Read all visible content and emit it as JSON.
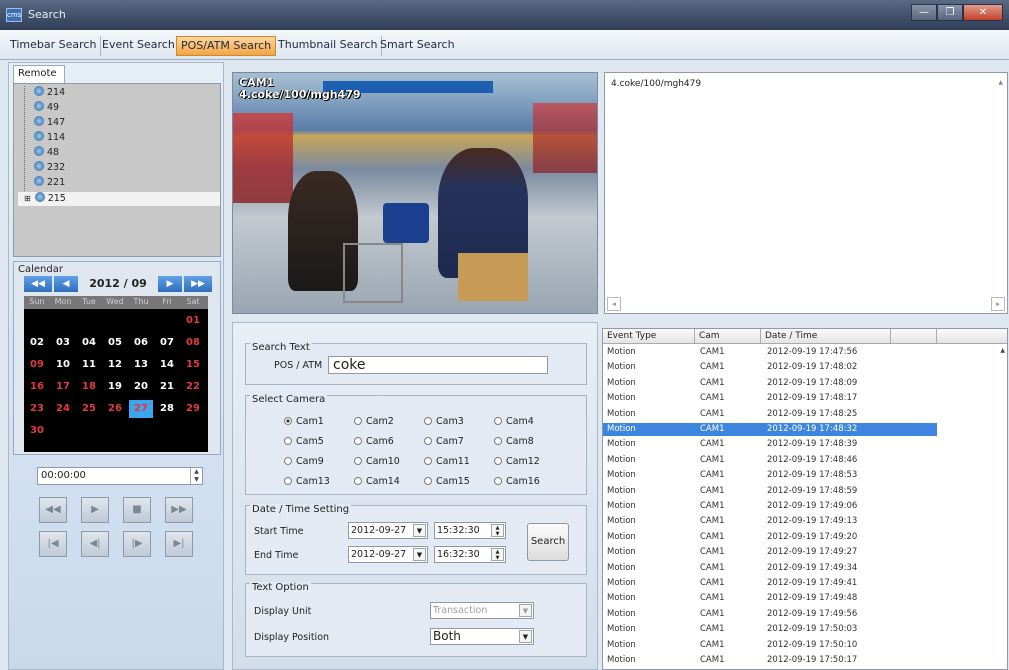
{
  "window": {
    "title": "Search",
    "app_icon": "cms",
    "buttons": [
      "—",
      "❐",
      "✕"
    ]
  },
  "tabs": [
    {
      "label": "Timebar Search",
      "active": false
    },
    {
      "label": "Event Search",
      "active": false
    },
    {
      "label": "POS/ATM Search",
      "active": true
    },
    {
      "label": "Thumbnail Search",
      "active": false
    },
    {
      "label": "Smart Search",
      "active": false
    }
  ],
  "remote": {
    "tab_label": "Remote",
    "items": [
      "214",
      "49",
      "147",
      "114",
      "48",
      "232",
      "221",
      "215"
    ],
    "selected_index": 7
  },
  "calendar": {
    "label": "Calendar",
    "month": "2012 / 09",
    "weekdays": [
      "Sun",
      "Mon",
      "Tue",
      "Wed",
      "Thu",
      "Fri",
      "Sat"
    ],
    "first_weekday_index": 6,
    "days_in_month": 30,
    "today": 27,
    "red_days": [
      1,
      8,
      9,
      15,
      16,
      17,
      18,
      22,
      23,
      24,
      25,
      26,
      29,
      30
    ]
  },
  "playback": {
    "time": "00:00:00",
    "row1": [
      "◀◀",
      "▶",
      "■",
      "▶▶"
    ],
    "row2": [
      "|◀",
      "◀|",
      "|▶",
      "▶|"
    ]
  },
  "video": {
    "camera": "CAM1",
    "overlay": "4.coke/100/mgh479"
  },
  "text_panel": {
    "content": "4.coke/100/mgh479"
  },
  "search": {
    "search_text": {
      "title": "Search Text",
      "label": "POS / ATM",
      "value": "coke"
    },
    "select_camera": {
      "title": "Select Camera",
      "cameras": [
        "Cam1",
        "Cam2",
        "Cam3",
        "Cam4",
        "Cam5",
        "Cam6",
        "Cam7",
        "Cam8",
        "Cam9",
        "Cam10",
        "Cam11",
        "Cam12",
        "Cam13",
        "Cam14",
        "Cam15",
        "Cam16"
      ],
      "selected": "Cam1"
    },
    "datetime": {
      "title": "Date / Time Setting",
      "start_label": "Start Time",
      "start_date": "2012-09-27",
      "start_time": "15:32:30",
      "end_label": "End Time",
      "end_date": "2012-09-27",
      "end_time": "16:32:30",
      "search_button": "Search"
    },
    "text_option": {
      "title": "Text Option",
      "unit_label": "Display Unit",
      "unit_value": "Transaction",
      "position_label": "Display Position",
      "position_value": "Both"
    }
  },
  "events": {
    "columns": [
      "Event Type",
      "Cam",
      "Date / Time",
      ""
    ],
    "selected_index": 5,
    "rows": [
      {
        "type": "Motion",
        "cam": "CAM1",
        "time": "2012-09-19 17:47:56"
      },
      {
        "type": "Motion",
        "cam": "CAM1",
        "time": "2012-09-19 17:48:02"
      },
      {
        "type": "Motion",
        "cam": "CAM1",
        "time": "2012-09-19 17:48:09"
      },
      {
        "type": "Motion",
        "cam": "CAM1",
        "time": "2012-09-19 17:48:17"
      },
      {
        "type": "Motion",
        "cam": "CAM1",
        "time": "2012-09-19 17:48:25"
      },
      {
        "type": "Motion",
        "cam": "CAM1",
        "time": "2012-09-19 17:48:32"
      },
      {
        "type": "Motion",
        "cam": "CAM1",
        "time": "2012-09-19 17:48:39"
      },
      {
        "type": "Motion",
        "cam": "CAM1",
        "time": "2012-09-19 17:48:46"
      },
      {
        "type": "Motion",
        "cam": "CAM1",
        "time": "2012-09-19 17:48:53"
      },
      {
        "type": "Motion",
        "cam": "CAM1",
        "time": "2012-09-19 17:48:59"
      },
      {
        "type": "Motion",
        "cam": "CAM1",
        "time": "2012-09-19 17:49:06"
      },
      {
        "type": "Motion",
        "cam": "CAM1",
        "time": "2012-09-19 17:49:13"
      },
      {
        "type": "Motion",
        "cam": "CAM1",
        "time": "2012-09-19 17:49:20"
      },
      {
        "type": "Motion",
        "cam": "CAM1",
        "time": "2012-09-19 17:49:27"
      },
      {
        "type": "Motion",
        "cam": "CAM1",
        "time": "2012-09-19 17:49:34"
      },
      {
        "type": "Motion",
        "cam": "CAM1",
        "time": "2012-09-19 17:49:41"
      },
      {
        "type": "Motion",
        "cam": "CAM1",
        "time": "2012-09-19 17:49:48"
      },
      {
        "type": "Motion",
        "cam": "CAM1",
        "time": "2012-09-19 17:49:56"
      },
      {
        "type": "Motion",
        "cam": "CAM1",
        "time": "2012-09-19 17:50:03"
      },
      {
        "type": "Motion",
        "cam": "CAM1",
        "time": "2012-09-19 17:50:10"
      },
      {
        "type": "Motion",
        "cam": "CAM1",
        "time": "2012-09-19 17:50:17"
      }
    ]
  },
  "colors": {
    "accent_tab": "#f2a445",
    "selection": "#3d86e0",
    "today": "#3aa6ee",
    "weekend": "#e13c3c"
  }
}
